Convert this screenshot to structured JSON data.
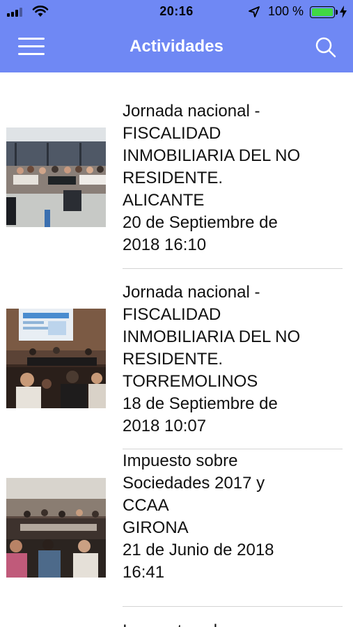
{
  "status_bar": {
    "time": "20:16",
    "battery": "100 %"
  },
  "nav": {
    "title": "Actividades",
    "menu_icon": "hamburger-menu-icon",
    "search_icon": "search-icon",
    "color": "#6f88f4"
  },
  "activities": [
    {
      "lines": [
        "Jornada nacional -",
        "FISCALIDAD",
        "INMOBILIARIA DEL NO",
        "RESIDENTE.",
        "ALICANTE"
      ],
      "date_lines": [
        "20 de Septiembre de",
        "2018 16:10"
      ]
    },
    {
      "lines": [
        "Jornada nacional -",
        "FISCALIDAD",
        "INMOBILIARIA DEL NO",
        "RESIDENTE.",
        "TORREMOLINOS"
      ],
      "date_lines": [
        "18 de Septiembre de",
        "2018 10:07"
      ]
    },
    {
      "lines": [
        "Impuesto sobre",
        "Sociedades 2017 y",
        "CCAA",
        "GIRONA"
      ],
      "date_lines": [
        "21 de Junio de 2018",
        "16:41"
      ]
    },
    {
      "lines": [
        "Impuesto sobre"
      ],
      "date_lines": []
    }
  ]
}
